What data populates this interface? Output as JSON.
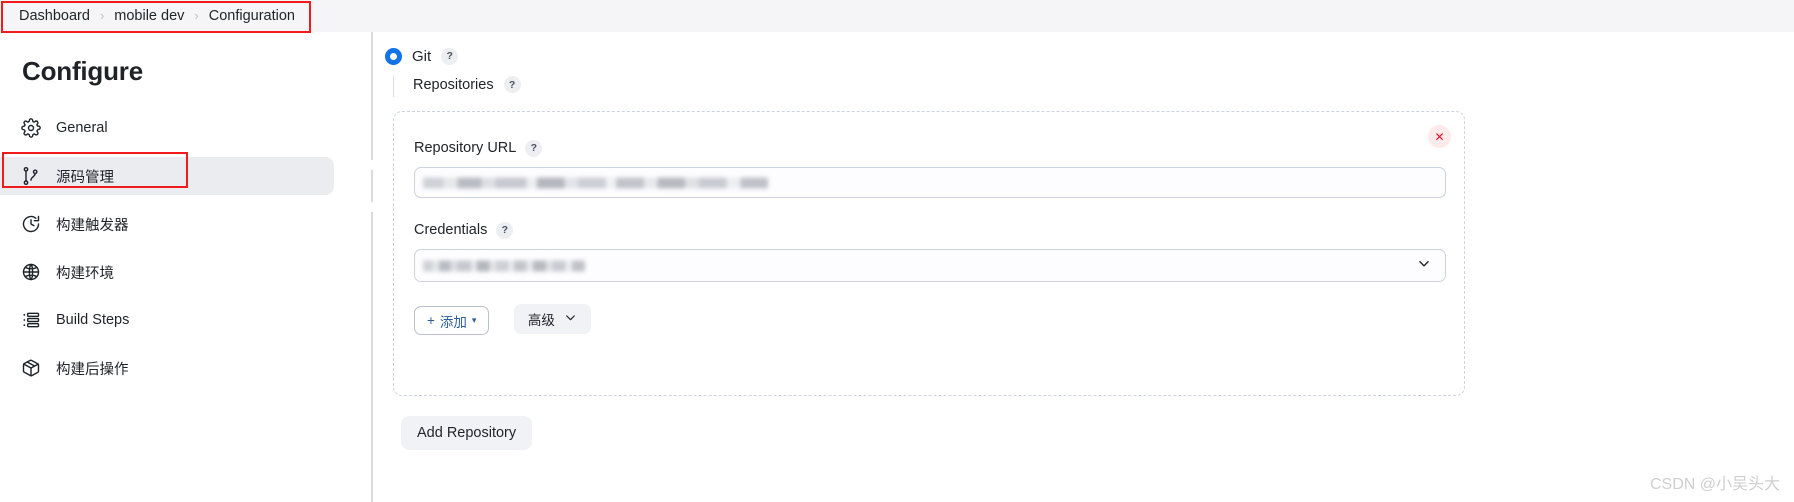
{
  "breadcrumb": {
    "items": [
      {
        "label": "Dashboard"
      },
      {
        "label": "mobile dev"
      },
      {
        "label": "Configuration"
      }
    ],
    "separator": "›"
  },
  "sidebar": {
    "title": "Configure",
    "items": [
      {
        "label": "General",
        "icon": "gear-icon",
        "active": false
      },
      {
        "label": "源码管理",
        "icon": "git-branch-icon",
        "active": true
      },
      {
        "label": "构建触发器",
        "icon": "clock-icon",
        "active": false
      },
      {
        "label": "构建环境",
        "icon": "globe-icon",
        "active": false
      },
      {
        "label": "Build Steps",
        "icon": "list-icon",
        "active": false
      },
      {
        "label": "构建后操作",
        "icon": "package-icon",
        "active": false
      }
    ]
  },
  "main": {
    "scm": {
      "selected_label": "Git",
      "help_glyph": "?",
      "sub_label": "Repositories"
    },
    "repository": {
      "close_glyph": "✕",
      "url_field": {
        "label": "Repository URL",
        "help_glyph": "?",
        "value": "",
        "placeholder": ""
      },
      "credentials_field": {
        "label": "Credentials",
        "help_glyph": "?",
        "value": "",
        "chevron": "chevron-down-icon"
      },
      "add_credential_button": {
        "plus": "+",
        "label": "添加",
        "caret": "▾"
      },
      "advanced_button": {
        "label": "高级",
        "chevron": "∨"
      }
    },
    "add_repository_button": {
      "label": "Add Repository"
    }
  },
  "watermark": {
    "text": "CSDN @小吴头大"
  },
  "colors": {
    "accent": "#1273e6",
    "annotation": "#f21a1a",
    "danger": "#e8102a",
    "sidebar_active_bg": "#ebecf0",
    "topbar_bg": "#f5f5f7",
    "link": "#2c5d9b"
  }
}
